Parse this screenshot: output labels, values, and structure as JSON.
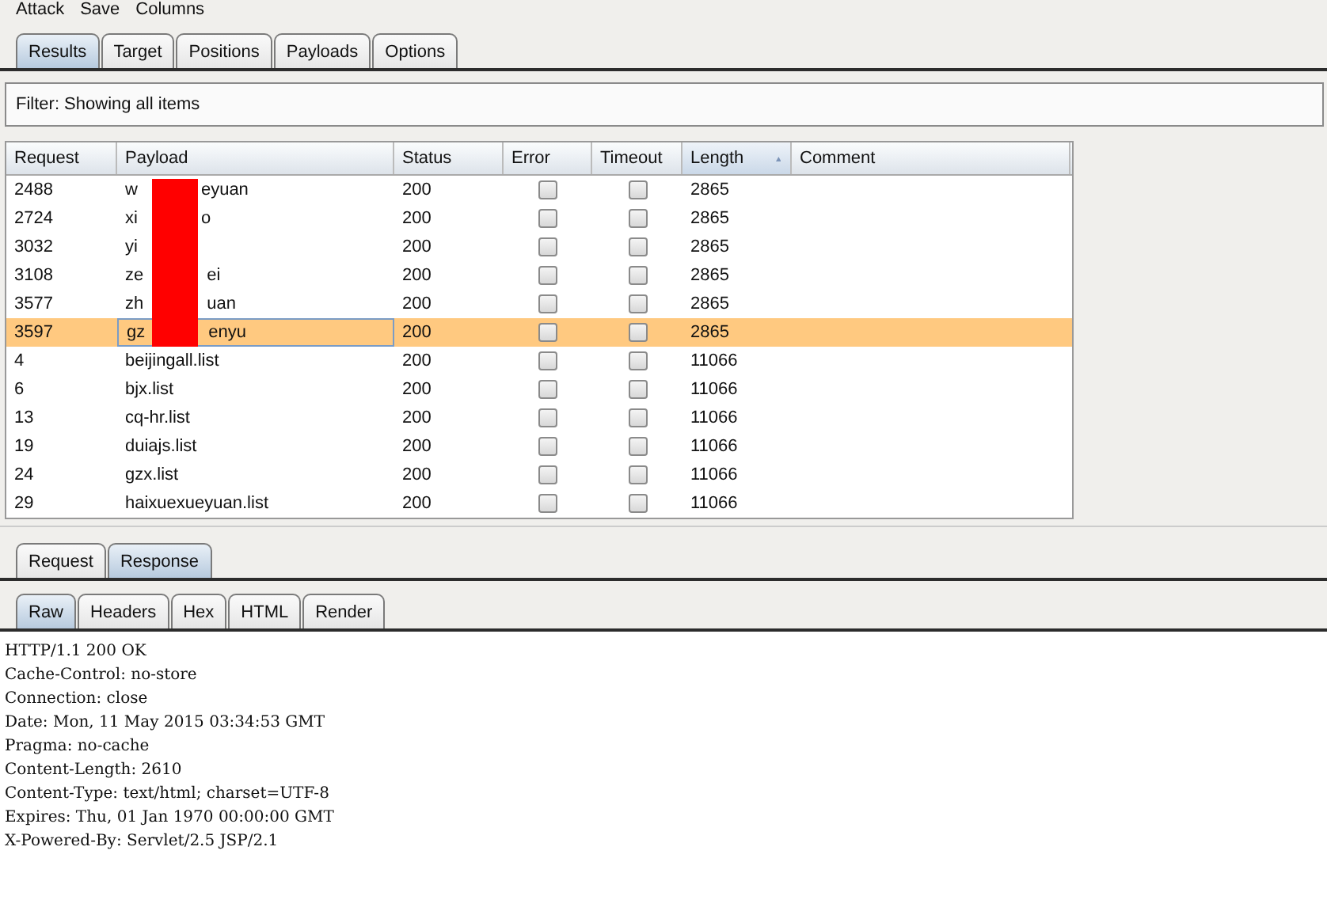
{
  "menu": [
    "Attack",
    "Save",
    "Columns"
  ],
  "tabs": [
    {
      "label": "Results",
      "selected": true
    },
    {
      "label": "Target",
      "selected": false
    },
    {
      "label": "Positions",
      "selected": false
    },
    {
      "label": "Payloads",
      "selected": false
    },
    {
      "label": "Options",
      "selected": false
    }
  ],
  "filter": "Filter:  Showing all items",
  "table": {
    "columns": [
      {
        "label": "Request",
        "sorted": false
      },
      {
        "label": "Payload",
        "sorted": false
      },
      {
        "label": "Status",
        "sorted": false
      },
      {
        "label": "Error",
        "sorted": false
      },
      {
        "label": "Timeout",
        "sorted": false
      },
      {
        "label": "Length",
        "sorted": true
      },
      {
        "label": "Comment",
        "sorted": false
      }
    ],
    "rows": [
      {
        "request": "2488",
        "payload_before": "w",
        "payload_after": "eyuan",
        "redacted": true,
        "status": "200",
        "error": false,
        "timeout": false,
        "length": "2865",
        "selected": false
      },
      {
        "request": "2724",
        "payload_before": "xi",
        "payload_after": "o",
        "redacted": true,
        "status": "200",
        "error": false,
        "timeout": false,
        "length": "2865",
        "selected": false
      },
      {
        "request": "3032",
        "payload_before": "yi",
        "payload_after": "",
        "redacted": true,
        "status": "200",
        "error": false,
        "timeout": false,
        "length": "2865",
        "selected": false
      },
      {
        "request": "3108",
        "payload_before": "ze",
        "payload_after": "ei",
        "redacted": true,
        "status": "200",
        "error": false,
        "timeout": false,
        "length": "2865",
        "selected": false
      },
      {
        "request": "3577",
        "payload_before": "zh",
        "payload_after": "uan",
        "redacted": true,
        "status": "200",
        "error": false,
        "timeout": false,
        "length": "2865",
        "selected": false
      },
      {
        "request": "3597",
        "payload_before": "gz",
        "payload_after": "enyu",
        "redacted": true,
        "status": "200",
        "error": false,
        "timeout": false,
        "length": "2865",
        "selected": true
      },
      {
        "request": "4",
        "payload_before": "beijingall.list",
        "payload_after": "",
        "redacted": false,
        "status": "200",
        "error": false,
        "timeout": false,
        "length": "11066",
        "selected": false
      },
      {
        "request": "6",
        "payload_before": "bjx.list",
        "payload_after": "",
        "redacted": false,
        "status": "200",
        "error": false,
        "timeout": false,
        "length": "11066",
        "selected": false
      },
      {
        "request": "13",
        "payload_before": "cq-hr.list",
        "payload_after": "",
        "redacted": false,
        "status": "200",
        "error": false,
        "timeout": false,
        "length": "11066",
        "selected": false
      },
      {
        "request": "19",
        "payload_before": "duiajs.list",
        "payload_after": "",
        "redacted": false,
        "status": "200",
        "error": false,
        "timeout": false,
        "length": "11066",
        "selected": false
      },
      {
        "request": "24",
        "payload_before": "gzx.list",
        "payload_after": "",
        "redacted": false,
        "status": "200",
        "error": false,
        "timeout": false,
        "length": "11066",
        "selected": false
      },
      {
        "request": "29",
        "payload_before": "haixuexueyuan.list",
        "payload_after": "",
        "redacted": false,
        "status": "200",
        "error": false,
        "timeout": false,
        "length": "11066",
        "selected": false
      }
    ]
  },
  "message_tabs": [
    {
      "label": "Request",
      "selected": false
    },
    {
      "label": "Response",
      "selected": true
    }
  ],
  "view_tabs": [
    {
      "label": "Raw",
      "selected": true
    },
    {
      "label": "Headers",
      "selected": false
    },
    {
      "label": "Hex",
      "selected": false
    },
    {
      "label": "HTML",
      "selected": false
    },
    {
      "label": "Render",
      "selected": false
    }
  ],
  "response_lines": [
    "HTTP/1.1 200 OK",
    "Cache-Control: no-store",
    "Connection: close",
    "Date: Mon, 11 May 2015 03:34:53 GMT",
    "Pragma: no-cache",
    "Content-Length: 2610",
    "Content-Type: text/html; charset=UTF-8",
    "Expires: Thu, 01 Jan 1970 00:00:00 GMT",
    "X-Powered-By: Servlet/2.5 JSP/2.1"
  ]
}
